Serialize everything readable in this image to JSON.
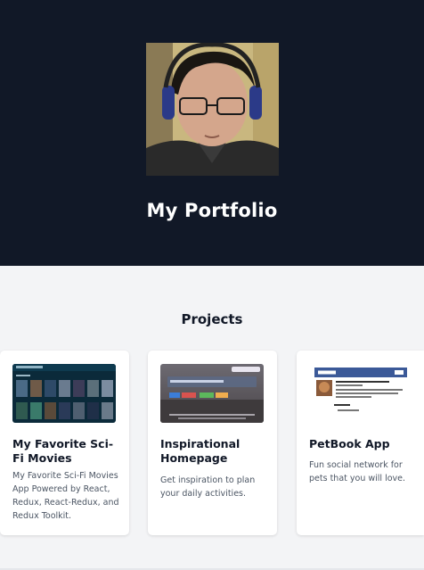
{
  "hero": {
    "title": "My Portfolio"
  },
  "projects": {
    "heading": "Projects",
    "items": [
      {
        "title": "My Favorite Sci-Fi Movies",
        "description": "My Favorite Sci-Fi Movies App Powered by React, Redux, React-Redux, and Redux Toolkit."
      },
      {
        "title": "Inspirational Homepage",
        "description": "Get inspiration to plan your daily activities."
      },
      {
        "title": "PetBook App",
        "description": "Fun social network for pets that you will love."
      }
    ]
  },
  "colors": {
    "hero_bg": "#111827",
    "page_bg": "#f3f4f6",
    "card_bg": "#ffffff",
    "petbook_brand": "#3b5998"
  }
}
